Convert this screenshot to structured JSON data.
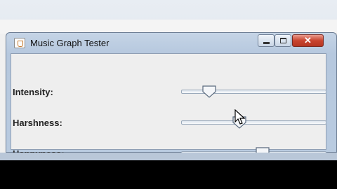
{
  "window": {
    "title": "Music Graph Tester"
  },
  "sliders": [
    {
      "label": "Intensity:",
      "value_fraction": 0.19
    },
    {
      "label": "Harshness:",
      "value_fraction": 0.4
    },
    {
      "label": "Happyness:",
      "value_fraction": 0.56
    }
  ],
  "colors": {
    "close_button": "#c9442f",
    "titlebar": "#c5d4e6",
    "content_bg": "#eeeeee",
    "thumb": "#f4f6f9"
  },
  "icons": [
    "java-app-icon",
    "minimize-icon",
    "maximize-icon",
    "close-icon",
    "mouse-cursor-icon"
  ]
}
